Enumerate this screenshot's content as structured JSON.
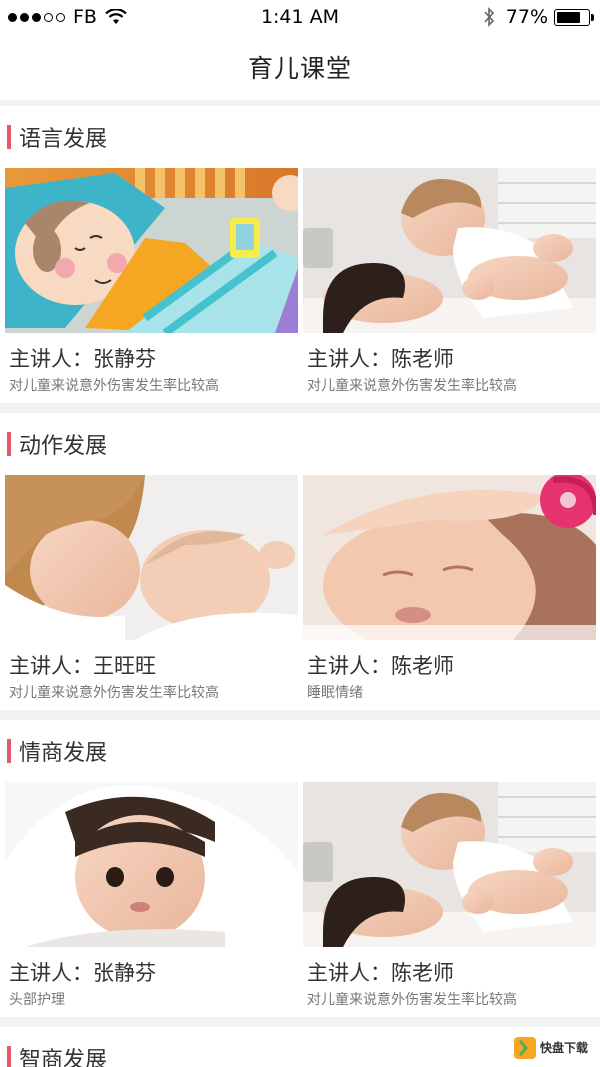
{
  "status_bar": {
    "carrier": "FB",
    "time": "1:41 AM",
    "battery": "77%",
    "battery_level": 0.77
  },
  "nav": {
    "title": "育儿课堂"
  },
  "sections": [
    {
      "title": "语言发展",
      "cards": [
        {
          "speaker": "主讲人：张静芬",
          "desc": "对儿童来说意外伤害发生率比较高",
          "image": "cartoon-child-bed-image"
        },
        {
          "speaker": "主讲人：陈老师",
          "desc": "对儿童来说意外伤害发生率比较高",
          "image": "mother-lifting-baby-image"
        }
      ]
    },
    {
      "title": "动作发展",
      "cards": [
        {
          "speaker": "主讲人：王旺旺",
          "desc": "对儿童来说意外伤害发生率比较高",
          "image": "mother-sleeping-baby-image"
        },
        {
          "speaker": "主讲人：陈老师",
          "desc": "睡眠情绪",
          "image": "sleeping-newborn-image"
        }
      ]
    },
    {
      "title": "情商发展",
      "cards": [
        {
          "speaker": "主讲人：张静芬",
          "desc": "头部护理",
          "image": "baby-under-blanket-image"
        },
        {
          "speaker": "主讲人：陈老师",
          "desc": "对儿童来说意外伤害发生率比较高",
          "image": "mother-lifting-baby-image"
        }
      ]
    },
    {
      "title": "智商发展",
      "cards": []
    }
  ],
  "watermark": {
    "logo_text": "快",
    "text": "盘下载"
  },
  "colors": {
    "accent": "#e5576a",
    "background": "#f2f2f4"
  }
}
